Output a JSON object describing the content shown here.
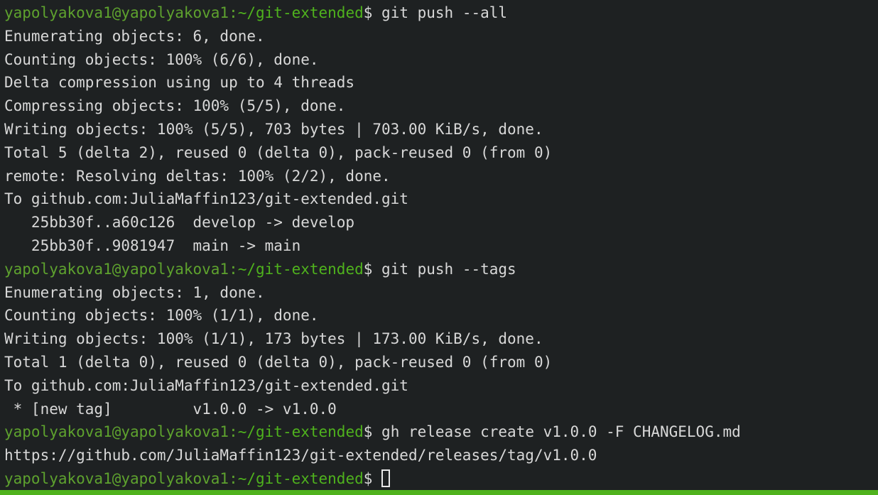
{
  "terminal": {
    "colors": {
      "background": "#1e2122",
      "text": "#d8d8d8",
      "prompt": "#5ea22e",
      "bottom_bar": "#4fb21d"
    },
    "prompt": {
      "user_host": "yapolyakova1@yapolyakova1",
      "separator": ":",
      "path": "~/git-extended",
      "symbol": "$ "
    },
    "lines": [
      {
        "type": "cmd",
        "text": "git push --all"
      },
      {
        "type": "out",
        "text": "Enumerating objects: 6, done."
      },
      {
        "type": "out",
        "text": "Counting objects: 100% (6/6), done."
      },
      {
        "type": "out",
        "text": "Delta compression using up to 4 threads"
      },
      {
        "type": "out",
        "text": "Compressing objects: 100% (5/5), done."
      },
      {
        "type": "out",
        "text": "Writing objects: 100% (5/5), 703 bytes | 703.00 KiB/s, done."
      },
      {
        "type": "out",
        "text": "Total 5 (delta 2), reused 0 (delta 0), pack-reused 0 (from 0)"
      },
      {
        "type": "out",
        "text": "remote: Resolving deltas: 100% (2/2), done."
      },
      {
        "type": "out",
        "text": "To github.com:JuliaMaffin123/git-extended.git"
      },
      {
        "type": "out",
        "text": "   25bb30f..a60c126  develop -> develop"
      },
      {
        "type": "out",
        "text": "   25bb30f..9081947  main -> main"
      },
      {
        "type": "cmd",
        "text": "git push --tags"
      },
      {
        "type": "out",
        "text": "Enumerating objects: 1, done."
      },
      {
        "type": "out",
        "text": "Counting objects: 100% (1/1), done."
      },
      {
        "type": "out",
        "text": "Writing objects: 100% (1/1), 173 bytes | 173.00 KiB/s, done."
      },
      {
        "type": "out",
        "text": "Total 1 (delta 0), reused 0 (delta 0), pack-reused 0 (from 0)"
      },
      {
        "type": "out",
        "text": "To github.com:JuliaMaffin123/git-extended.git"
      },
      {
        "type": "out",
        "text": " * [new tag]         v1.0.0 -> v1.0.0"
      },
      {
        "type": "cmd",
        "text": "gh release create v1.0.0 -F CHANGELOG.md"
      },
      {
        "type": "out",
        "text": "https://github.com/JuliaMaffin123/git-extended/releases/tag/v1.0.0"
      },
      {
        "type": "cmd",
        "text": "",
        "cursor": true
      }
    ]
  }
}
